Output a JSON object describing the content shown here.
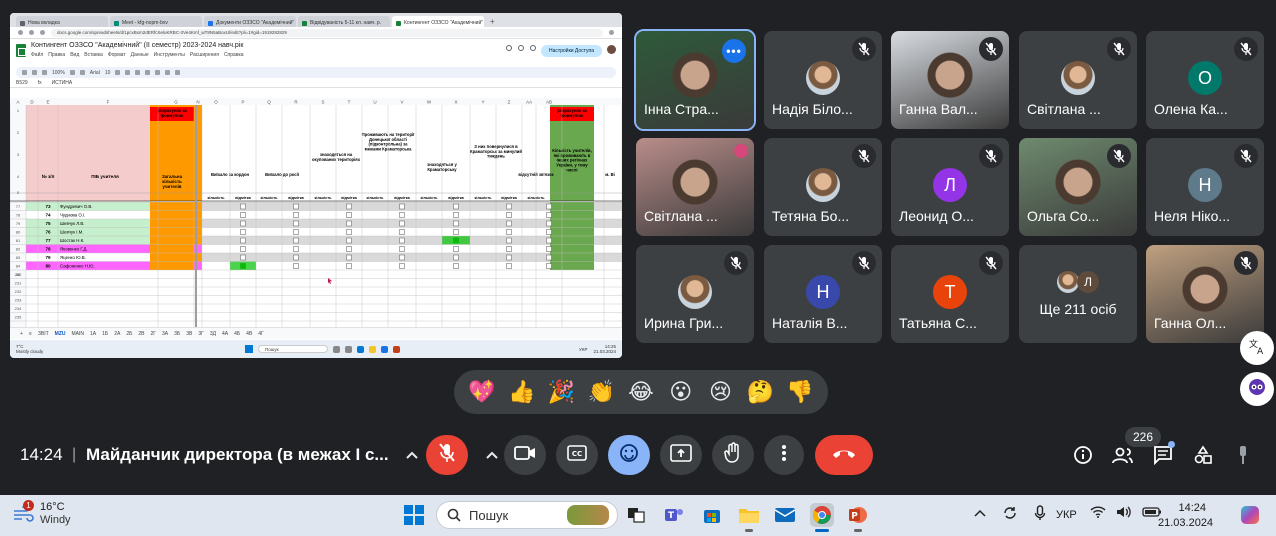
{
  "shared_screen": {
    "browser_tabs": [
      "Нова вкладка",
      "Meet - kfg-nopm-bxv",
      "Документи ОЗЗСО \"Академічний\"",
      "Відвідуваність 5-11 кл. навч. р.",
      "Контингент ОЗЗСО \"Академічний\""
    ],
    "url": "docs.google.com/spreadsheets/d/1pcxBxm2dERfcSeluKRBC-3Ve4Kmf_wT8N5aBoxUl/edit?pli=1#gid=1919282829",
    "sheet_title": "Контингент ОЗЗСО \"Академічний\" (ІІ семестр) 2023-2024 навч.рік",
    "menu": [
      "Файл",
      "Правка",
      "Вид",
      "Вставка",
      "Формат",
      "Данные",
      "Инструменты",
      "Расширения",
      "Справка"
    ],
    "share_label": "Настройки Доступа",
    "zoom": "100%",
    "font": "Arial",
    "font_size": "10",
    "cell_ref": "B529",
    "formula": "ИСТИНА",
    "col_letters": [
      "A",
      "D",
      "E",
      "F",
      "G",
      "N",
      "O",
      "P",
      "Q",
      "R",
      "S",
      "T",
      "U",
      "V",
      "W",
      "X",
      "Y",
      "Z",
      "AA",
      "AB"
    ],
    "headers": {
      "no": "№ з/п",
      "name": "ПІБ учителя",
      "total": "Загальна кількість учителів",
      "g1": "Виїхало за кордон",
      "g2": "Виїхало до росії",
      "g3": "знаходяться на окупованих територіях",
      "g4": "Проживають на території Донецької області (підконтрольна) за межами Краматорська",
      "g5": "знаходяться у Краматорську",
      "g6": "З них повернулися в Краматорськ за минулий тиждень",
      "g7": "відсутній зв'язок",
      "g8": "Кількість учителів, які проживають в інших регіонах України, у тому числі",
      "g9": "м. Ві",
      "sub_count": "кількість",
      "sub_mark": "відмітка",
      "red_note": "розрахунок за формулою",
      "red_note2": "розрахунок за формулою"
    },
    "row_numbers": [
      "1",
      "2",
      "3",
      "4",
      "5",
      "77",
      "78",
      "79",
      "80",
      "81",
      "82",
      "83",
      "84",
      "86",
      "230",
      "231",
      "232",
      "233",
      "234",
      "235"
    ],
    "rows": [
      {
        "no": "73",
        "name": "Фундревич О.В.",
        "color": "#c6efce"
      },
      {
        "no": "74",
        "name": "Чуднова О.І.",
        "color": "#ffffff"
      },
      {
        "no": "75",
        "name": "Шевчук Л.В.",
        "color": "#c6efce"
      },
      {
        "no": "76",
        "name": "Шевчук І.М.",
        "color": "#c6efce"
      },
      {
        "no": "77",
        "name": "Шостак Н.К.",
        "color": "#c6efce"
      },
      {
        "no": "78",
        "name": "Яковенко Г.Д.",
        "color": "#ff66ff"
      },
      {
        "no": "79",
        "name": "Яценко Ю.В.",
        "color": "#ffffff"
      },
      {
        "no": "80",
        "name": "Сафоненко Н.Ю.",
        "color": "#ff66ff"
      }
    ],
    "sheet_tabs": [
      "+",
      "≡",
      "ЗВІТ",
      "MZU",
      "MAIN",
      "1А",
      "1Б",
      "2А",
      "2Б",
      "2В",
      "2Г",
      "3А",
      "3Б",
      "3В",
      "3Г",
      "3Д",
      "4А",
      "4Б",
      "4В",
      "4Г"
    ],
    "active_sheet": "MZU",
    "mini_taskbar": {
      "temp": "7°C",
      "cond": "Mostly cloudy",
      "search": "Пошук",
      "lang": "УКР",
      "time": "14:25",
      "date": "21.03.2024"
    }
  },
  "participants": [
    {
      "name": "Інна Стра...",
      "type": "video",
      "active": true,
      "more": true
    },
    {
      "name": "Надія Біло...",
      "type": "photo",
      "muted": true
    },
    {
      "name": "Ганна Вал...",
      "type": "video",
      "muted": true
    },
    {
      "name": "Світлана ...",
      "type": "photo",
      "muted": true
    },
    {
      "name": "Олена Ка...",
      "type": "letter",
      "letter": "О",
      "color": "#00796b",
      "muted": true
    },
    {
      "name": "Світлана ...",
      "type": "video",
      "muted": false
    },
    {
      "name": "Тетяна Бо...",
      "type": "photo",
      "muted": true
    },
    {
      "name": "Леонид О...",
      "type": "letter",
      "letter": "Л",
      "color": "#9334e6",
      "muted": true
    },
    {
      "name": "Ольга Со...",
      "type": "video",
      "muted": true
    },
    {
      "name": "Неля Ніко...",
      "type": "letter",
      "letter": "Н",
      "color": "#5f7a8a",
      "muted": true
    },
    {
      "name": "Ирина Гри...",
      "type": "photo",
      "muted": true
    },
    {
      "name": "Наталія В...",
      "type": "letter",
      "letter": "Н",
      "color": "#3949ab",
      "muted": true
    },
    {
      "name": "Татьяна С...",
      "type": "letter",
      "letter": "Т",
      "color": "#e8430a",
      "muted": true
    },
    {
      "name": "Ще 211 осіб",
      "type": "others",
      "letter": "Л"
    },
    {
      "name": "Ганна Ол...",
      "type": "video",
      "muted": true
    }
  ],
  "reactions": [
    "💖",
    "👍",
    "🎉",
    "👏",
    "😂",
    "😮",
    "😢",
    "🤔",
    "👎"
  ],
  "meeting": {
    "time": "14:24",
    "separator": "|",
    "title": "Майданчик директора (в межах І с...",
    "people_count": "226"
  },
  "taskbar": {
    "temp": "16°C",
    "condition": "Windy",
    "notif": "1",
    "search": "Пошук",
    "lang": "УКР",
    "time": "14:24",
    "date": "21.03.2024"
  },
  "colors": {
    "bg": "#202124",
    "tile": "#3c4043",
    "hangup": "#ea4335",
    "accent": "#8ab4f8"
  }
}
